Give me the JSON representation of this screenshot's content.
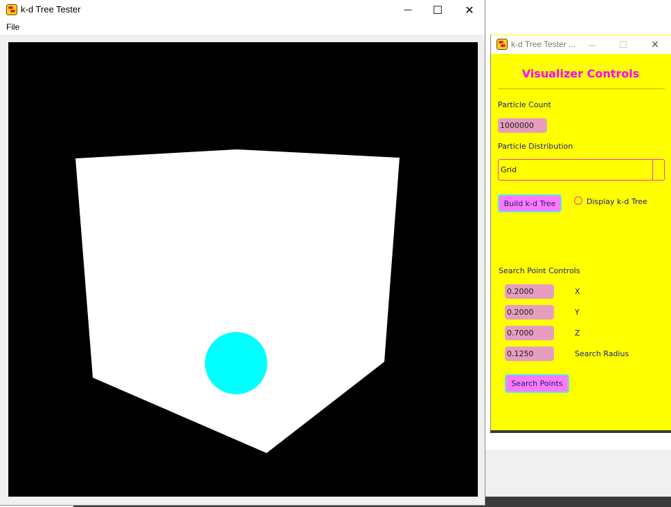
{
  "main_window": {
    "title": "k-d Tree Tester",
    "menu": [
      "File"
    ],
    "controls": {
      "minimize": "—",
      "maximize": "☐",
      "close": "✕"
    }
  },
  "scene": {
    "background": "#000000",
    "cube_color": "#ffffff",
    "sphere_color": "#00ffff"
  },
  "controls_window": {
    "title": "k-d Tree Tester ...",
    "window_controls": {
      "minimize": "—",
      "maximize": "☐",
      "close": "✕"
    },
    "heading": "Visualizer Controls",
    "particle_count": {
      "label": "Particle Count",
      "value": "1000000"
    },
    "particle_distribution": {
      "label": "Particle Distribution",
      "value": "Grid"
    },
    "build_button": "Build k-d Tree",
    "display_toggle": {
      "label": "Display k-d Tree",
      "checked": false
    },
    "search_controls_label": "Search Point Controls",
    "search_fields": [
      {
        "value": "0.2000",
        "label": "X"
      },
      {
        "value": "0.2000",
        "label": "Y"
      },
      {
        "value": "0.7000",
        "label": "Z"
      },
      {
        "value": "0.1250",
        "label": "Search Radius"
      }
    ],
    "search_button": "Search Points",
    "colors": {
      "background": "#ffff00",
      "heading": "#ff00ff",
      "field": "#e69ec0",
      "button": "#ff7aff"
    }
  }
}
